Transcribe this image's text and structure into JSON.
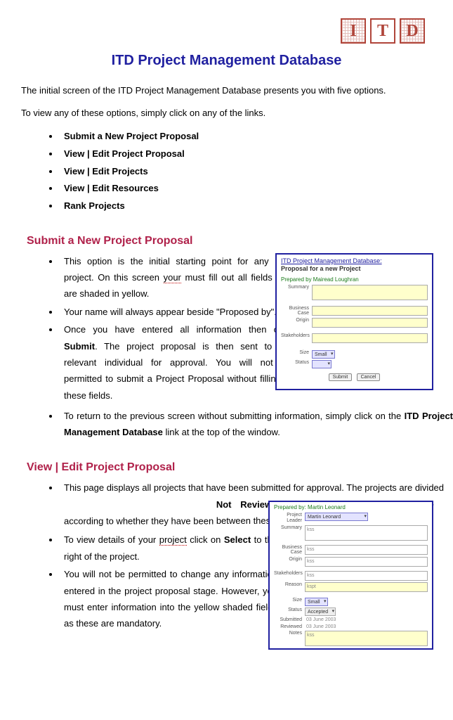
{
  "logo": {
    "letters": [
      "I",
      "T",
      "D"
    ]
  },
  "title": "ITD Project Management Database",
  "intro1": "The initial screen of the ITD Project Management Database presents you with five options.",
  "intro2": "To view any of these options, simply click on any of the links.",
  "options": [
    "Submit a New Project Proposal",
    "View | Edit Project Proposal",
    "View | Edit Projects",
    "View | Edit Resources",
    "Rank Projects"
  ],
  "section1": {
    "heading": "Submit a New Project Proposal",
    "b1a": "This option is the initial starting point for any new project. On this screen ",
    "b1your": "your",
    "b1b": " must fill out all fields that are shaded in yellow.",
    "b2": "Your name will always appear beside \"Proposed by\".",
    "b3a": "Once you have entered all information then click ",
    "b3submit": "Submit",
    "b3b": ". The project proposal is then sent to the relevant individual for approval. You will not be permitted to submit a Project Proposal without filling in these fields.",
    "b4a": "To return to the previous screen without submitting information, simply click on the ",
    "b4link": "ITD Project Management Database",
    "b4b": " link at the top of the window."
  },
  "shot1": {
    "title": "ITD Project Management Database:",
    "subtitle": "Proposal for a new Project",
    "prepared": "Prepared by Mairead Loughran",
    "labels": {
      "summary": "Summary",
      "bcase": "Business Case",
      "origin": "Origin",
      "stake": "Stakeholders",
      "size": "Size",
      "status": "Status"
    },
    "size_val": "Small",
    "btn_submit": "Submit",
    "btn_cancel": "Cancel"
  },
  "section2": {
    "heading": "View | Edit Project Proposal",
    "b1a": "This page displays all projects that have been submitted for approval. The projects are divided according to whether they have been ",
    "b1bold": "Not Reviewed, Accepted or Rejected.",
    "b1b": " Move between these three options to find your project.",
    "b2a": "To view details of your ",
    "b2proj": "project",
    "b2b": " click on ",
    "b2sel": "Select",
    "b2c": " to the right of the project.",
    "b3": "You will not be permitted to change any information entered in the project proposal stage. However, you must enter information into the yellow shaded fields as these are mandatory."
  },
  "shot2": {
    "prepared": "Prepared by: Martin Leonard",
    "labels": {
      "leader": "Project Leader",
      "summary": "Summary",
      "bcase": "Business Case",
      "origin": "Origin",
      "stake": "Stakeholders",
      "reason": "Reason",
      "size": "Size",
      "status": "Status",
      "submitted": "Submitted",
      "reviewed": "Reviewed",
      "notes": "Notes"
    },
    "leader_val": "Martin Leonard",
    "size_val": "Small",
    "status_val": "Accepted",
    "submitted_val": "03 June 2003",
    "reviewed_val": "03 June 2003",
    "reason_val": "kspt",
    "fval": "kss"
  }
}
